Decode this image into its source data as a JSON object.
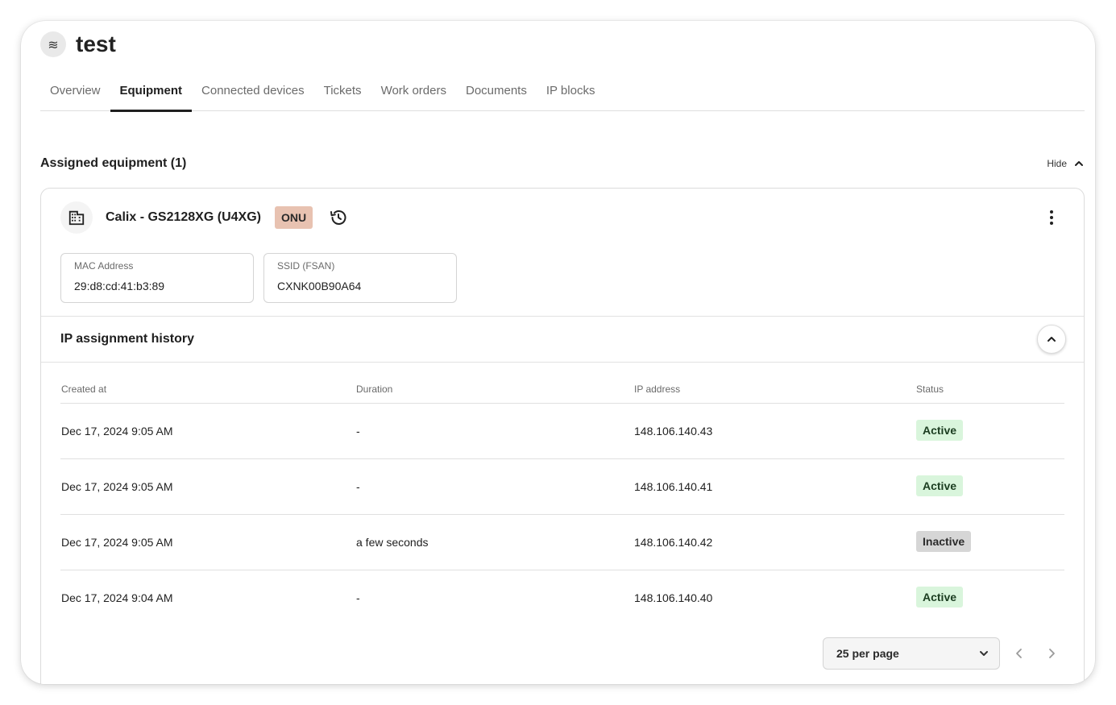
{
  "header": {
    "logo_glyph": "≋",
    "logo_icon": "waves-icon",
    "title": "test"
  },
  "tabs": [
    {
      "label": "Overview",
      "active": false
    },
    {
      "label": "Equipment",
      "active": true
    },
    {
      "label": "Connected devices",
      "active": false
    },
    {
      "label": "Tickets",
      "active": false
    },
    {
      "label": "Work orders",
      "active": false
    },
    {
      "label": "Documents",
      "active": false
    },
    {
      "label": "IP blocks",
      "active": false
    }
  ],
  "section": {
    "title": "Assigned equipment (1)",
    "hide_label": "Hide"
  },
  "equipment": {
    "name": "Calix - GS2128XG (U4XG)",
    "type_badge": "ONU",
    "fields": [
      {
        "label": "MAC Address",
        "value": "29:d8:cd:41:b3:89"
      },
      {
        "label": "SSID (FSAN)",
        "value": "CXNK00B90A64"
      }
    ]
  },
  "ip_history": {
    "title": "IP assignment history",
    "columns": [
      "Created at",
      "Duration",
      "IP address",
      "Status"
    ],
    "rows": [
      {
        "created_at": "Dec 17, 2024 9:05 AM",
        "duration": "-",
        "ip": "148.106.140.43",
        "status": "Active"
      },
      {
        "created_at": "Dec 17, 2024 9:05 AM",
        "duration": "-",
        "ip": "148.106.140.41",
        "status": "Active"
      },
      {
        "created_at": "Dec 17, 2024 9:05 AM",
        "duration": "a few seconds",
        "ip": "148.106.140.42",
        "status": "Inactive"
      },
      {
        "created_at": "Dec 17, 2024 9:04 AM",
        "duration": "-",
        "ip": "148.106.140.40",
        "status": "Active"
      }
    ]
  },
  "pagination": {
    "per_page_label": "25 per page"
  },
  "colors": {
    "onu_badge": "#e8c2b1",
    "active_bg": "#d9f5dc",
    "inactive_bg": "#d6d6d6",
    "accent": "#1f1f1f"
  }
}
